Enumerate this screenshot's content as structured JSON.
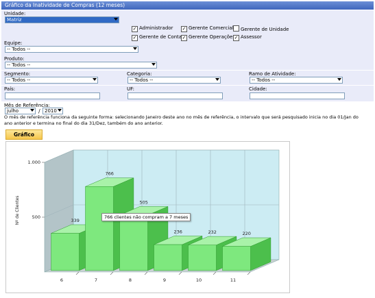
{
  "window": {
    "title": "Gráfico da Inatividade de Compras (12 meses)"
  },
  "filters": {
    "unidade_label": "Unidade:",
    "unidade_value": "Matriz",
    "checkboxes": [
      {
        "label": "Administrador",
        "checked": true
      },
      {
        "label": "Gerente Comercial",
        "checked": true
      },
      {
        "label": "Gerente de Unidade",
        "checked": false
      },
      {
        "label": "Gerente de Contas",
        "checked": true
      },
      {
        "label": "Gerente Operações",
        "checked": true
      },
      {
        "label": "Assessor",
        "checked": true
      }
    ],
    "equipe_label": "Equipe:",
    "equipe_value": "-- Todos --",
    "produto_label": "Produto:",
    "produto_value": "-- Todos --",
    "segmento_label": "Segmento:",
    "segmento_value": "-- Todos --",
    "categoria_label": "Categoria:",
    "categoria_value": "-- Todos --",
    "ramo_label": "Ramo de Atividade:",
    "ramo_value": "-- Todos --",
    "pais_label": "País:",
    "uf_label": "UF:",
    "cidade_label": "Cidade:",
    "mes_ref_label": "Mês de Referência:",
    "mes_value": "julho",
    "sep": "/",
    "ano_value": "2010",
    "note": "O mês de referência funciona da seguinte forma: selecionando Janeiro deste ano no mês de referência, o intervalo que será pesquisado inicia no dia 01/Jan do ano anterior e termina no final do dia 31/Dez, também do ano anterior."
  },
  "actions": {
    "grafico_label": "Gráfico"
  },
  "tooltip": "766 clientes não compram a 7 meses",
  "colors": {
    "bar_front": "#7ee87e",
    "bar_side": "#4cbf4c",
    "bar_top": "#a9f2a9",
    "wall": "#ccecf3",
    "side_wall": "#b3c4c8",
    "floor": "#c9d2d4"
  },
  "chart_data": {
    "type": "bar",
    "categories": [
      "6",
      "7",
      "8",
      "9",
      "10",
      "11"
    ],
    "values": [
      339,
      766,
      505,
      236,
      232,
      220
    ],
    "ylabel": "Nº de Clientes",
    "xlabel": "",
    "yticks": [
      "1.000",
      "500"
    ],
    "ylim": [
      0,
      1000
    ],
    "grid": true
  }
}
